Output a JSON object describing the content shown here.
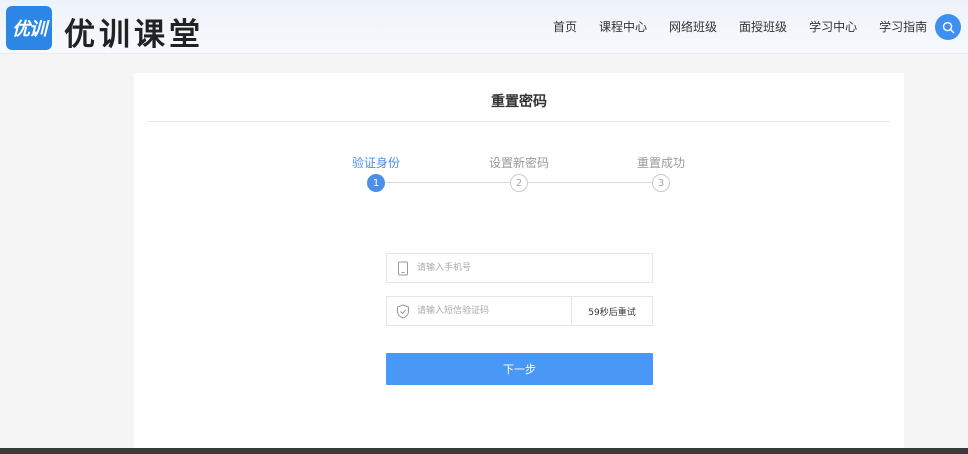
{
  "header": {
    "logo_badge": "优训",
    "logo_text": "优训课堂",
    "nav": [
      "首页",
      "课程中心",
      "网络班级",
      "面授班级",
      "学习中心",
      "学习指南"
    ],
    "search_icon": "search-icon",
    "accent": "#3e8ff0"
  },
  "main": {
    "title": "重置密码",
    "steps": [
      {
        "label": "验证身份",
        "num": "1",
        "state": "active"
      },
      {
        "label": "设置新密码",
        "num": "2",
        "state": "pending"
      },
      {
        "label": "重置成功",
        "num": "3",
        "state": "pending"
      }
    ],
    "phone": {
      "placeholder": "请输入手机号",
      "icon": "phone-icon"
    },
    "sms": {
      "placeholder": "请输入短信验证码",
      "icon": "shield-check-icon",
      "countdown": "59秒后重试"
    },
    "next_label": "下一步",
    "button_color": "#4a98f5"
  }
}
